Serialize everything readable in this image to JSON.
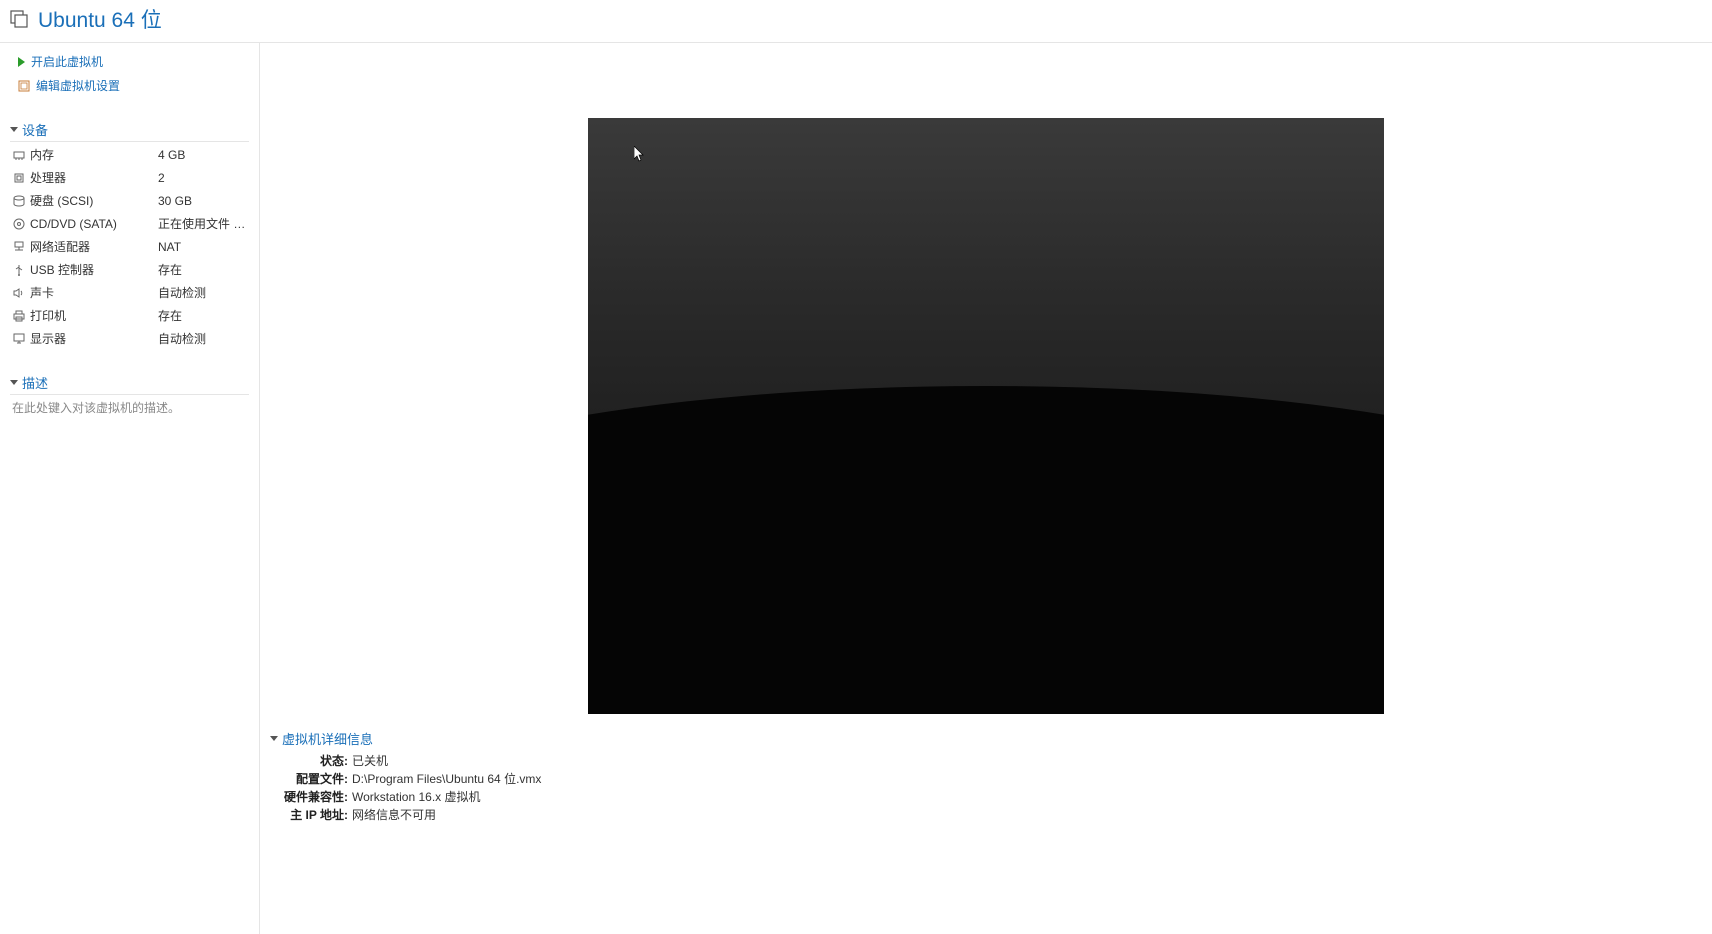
{
  "header": {
    "title": "Ubuntu 64 位"
  },
  "actions": {
    "power_on": "开启此虚拟机",
    "edit_settings": "编辑虚拟机设置"
  },
  "sections": {
    "devices_title": "设备",
    "description_title": "描述",
    "description_placeholder": "在此处键入对该虚拟机的描述。"
  },
  "devices": [
    {
      "icon": "memory-icon",
      "label": "内存",
      "value": "4 GB"
    },
    {
      "icon": "cpu-icon",
      "label": "处理器",
      "value": "2"
    },
    {
      "icon": "disk-icon",
      "label": "硬盘 (SCSI)",
      "value": "30 GB"
    },
    {
      "icon": "disc-icon",
      "label": "CD/DVD (SATA)",
      "value": "正在使用文件 D:..."
    },
    {
      "icon": "network-icon",
      "label": "网络适配器",
      "value": "NAT"
    },
    {
      "icon": "usb-icon",
      "label": "USB 控制器",
      "value": "存在"
    },
    {
      "icon": "sound-icon",
      "label": "声卡",
      "value": "自动检测"
    },
    {
      "icon": "printer-icon",
      "label": "打印机",
      "value": "存在"
    },
    {
      "icon": "display-icon",
      "label": "显示器",
      "value": "自动检测"
    }
  ],
  "details": {
    "title": "虚拟机详细信息",
    "rows": [
      {
        "label": "状态:",
        "value": "已关机"
      },
      {
        "label": "配置文件:",
        "value": "D:\\Program Files\\Ubuntu 64 位.vmx"
      },
      {
        "label": "硬件兼容性:",
        "value": "Workstation 16.x 虚拟机"
      },
      {
        "label": "主 IP 地址:",
        "value": "网络信息不可用"
      }
    ]
  }
}
